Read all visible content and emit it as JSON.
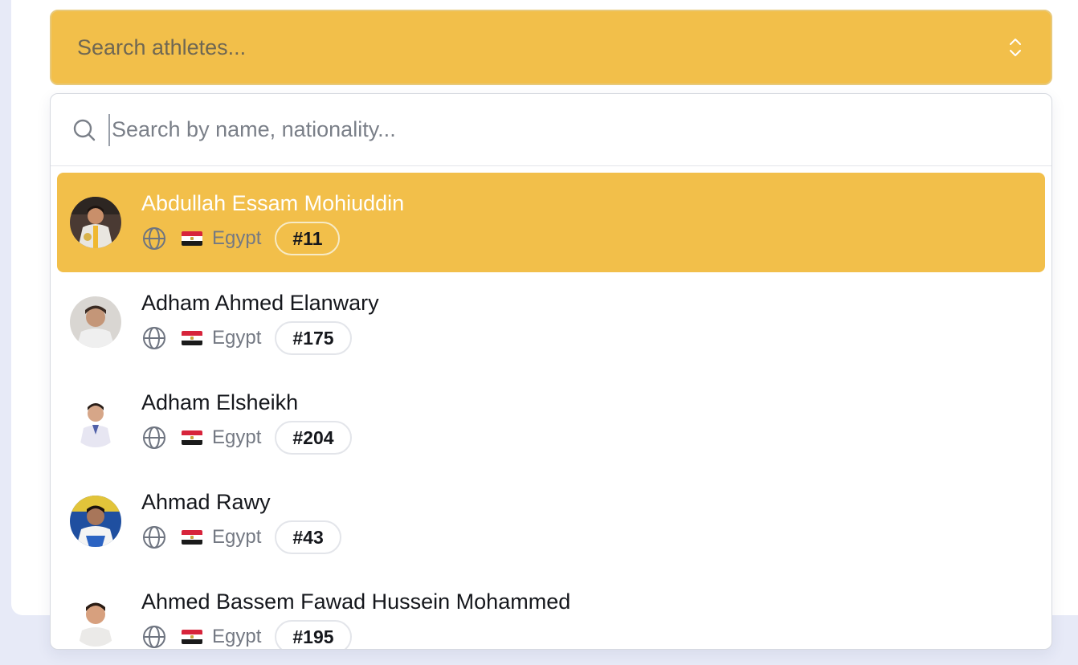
{
  "combobox": {
    "placeholder": "Search athletes...",
    "icon": "chevron-up-down-icon"
  },
  "dropdown": {
    "search_placeholder": "Search by name, nationality...",
    "search_icon": "search-icon",
    "items": [
      {
        "name": "Abdullah Essam Mohiuddin",
        "country": "Egypt",
        "rank": "#11",
        "selected": true
      },
      {
        "name": "Adham Ahmed Elanwary",
        "country": "Egypt",
        "rank": "#175",
        "selected": false
      },
      {
        "name": "Adham Elsheikh",
        "country": "Egypt",
        "rank": "#204",
        "selected": false
      },
      {
        "name": "Ahmad Rawy",
        "country": "Egypt",
        "rank": "#43",
        "selected": false
      },
      {
        "name": "Ahmed Bassem Fawad Hussein Mohammed",
        "country": "Egypt",
        "rank": "#195",
        "selected": false
      }
    ]
  },
  "colors": {
    "accent": "#f2bf4a",
    "background": "#e7eaf7",
    "text": "#15171c",
    "muted": "#747983"
  }
}
